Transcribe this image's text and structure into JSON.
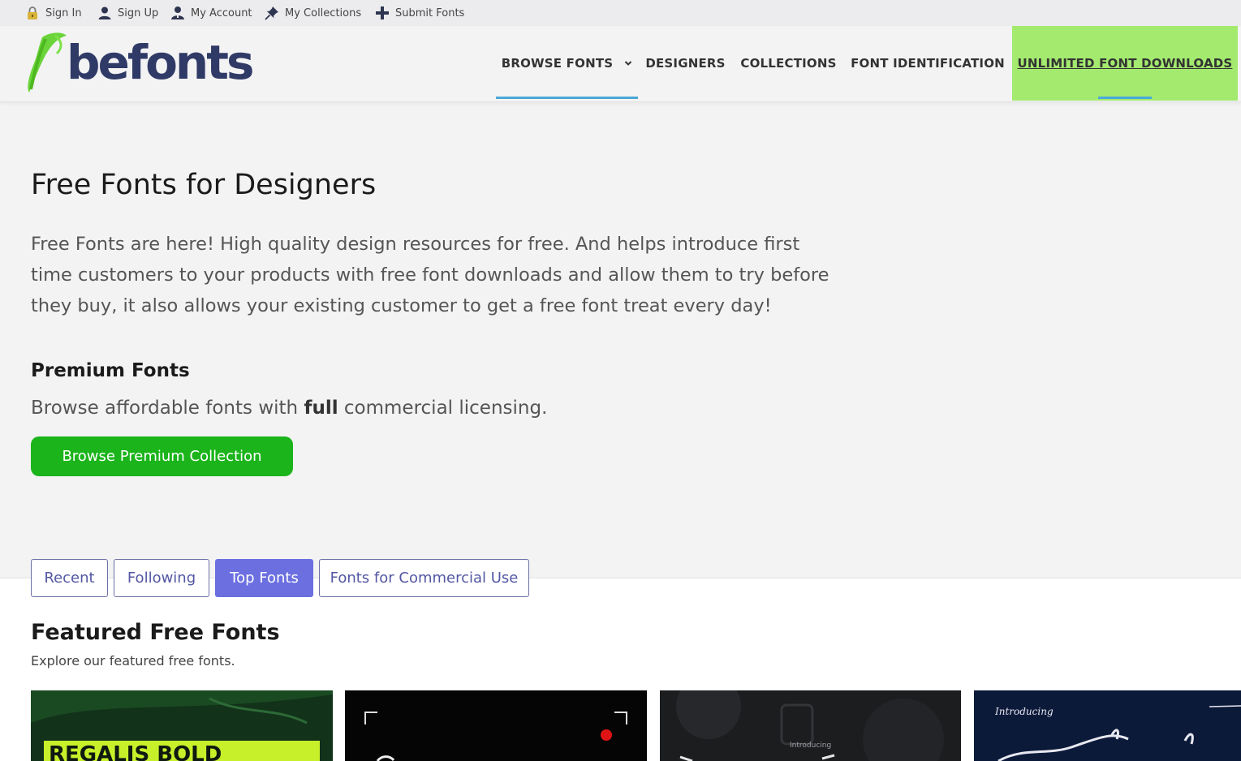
{
  "topbar": {
    "links": [
      {
        "label": "Sign In",
        "icon": "lock-icon"
      },
      {
        "label": "Sign Up",
        "icon": "user-icon"
      },
      {
        "label": "My Account",
        "icon": "account-icon"
      },
      {
        "label": "My Collections",
        "icon": "pin-icon"
      },
      {
        "label": "Submit Fonts",
        "icon": "plus-icon"
      }
    ]
  },
  "header": {
    "logo_text": "befonts",
    "nav": [
      {
        "label": "BROWSE FONTS",
        "has_dropdown": true
      },
      {
        "label": "DESIGNERS"
      },
      {
        "label": "COLLECTIONS"
      },
      {
        "label": "FONT IDENTIFICATION"
      },
      {
        "label": "UNLIMITED FONT DOWNLOADS"
      }
    ]
  },
  "hero": {
    "title": "Free Fonts for Designers",
    "text": "Free Fonts are here! High quality design resources for free. And helps introduce first time customers to your products with free font downloads and allow them to try before they buy, it also allows your existing customer to get a free font treat every day!"
  },
  "premium": {
    "title": "Premium Fonts",
    "text_before": "Browse affordable fonts with ",
    "text_bold": "full",
    "text_after": " commercial licensing.",
    "button": "Browse Premium Collection"
  },
  "tabs": [
    {
      "label": "Recent",
      "active": false
    },
    {
      "label": "Following",
      "active": false
    },
    {
      "label": "Top Fonts",
      "active": true
    },
    {
      "label": "Fonts for Commercial Use",
      "active": false
    }
  ],
  "featured": {
    "title": "Featured Free Fonts",
    "subtitle": "Explore our featured free fonts.",
    "cards": [
      {
        "name": "font-card-1",
        "text": "REGALIS BOLD"
      },
      {
        "name": "font-card-2",
        "text": ""
      },
      {
        "name": "font-card-3",
        "text": "Introducing"
      },
      {
        "name": "font-card-4",
        "text": "Introducing"
      }
    ]
  },
  "colors": {
    "accent_green": "#1bb41b",
    "promo_green": "#a3ea6e",
    "tab_active": "#6b6fe0",
    "nav_underline": "#4aa8d8",
    "logo_navy": "#303a66"
  }
}
